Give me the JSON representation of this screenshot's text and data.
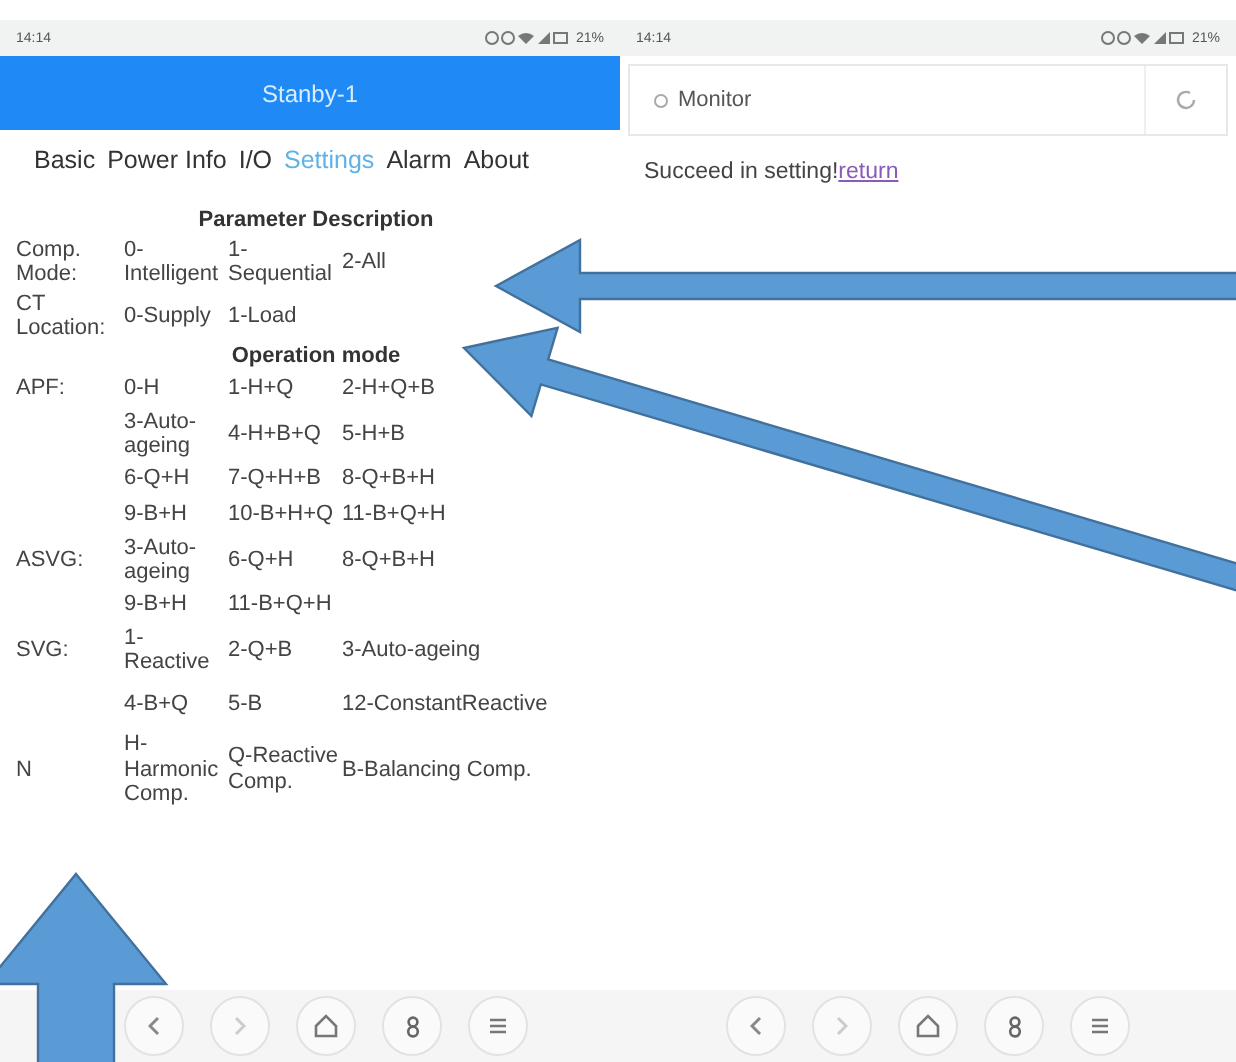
{
  "left_screen": {
    "status_bar": {
      "time": "14:14",
      "battery": "21%"
    },
    "title": "Stanby-1",
    "tabs": [
      {
        "label": "Basic",
        "selected": false
      },
      {
        "label": "Power Info",
        "selected": false
      },
      {
        "label": "I/O",
        "selected": false
      },
      {
        "label": "Settings",
        "selected": true
      },
      {
        "label": "Alarm",
        "selected": false
      },
      {
        "label": "About",
        "selected": false
      }
    ],
    "sections": [
      {
        "heading": "Parameter Description",
        "rows": [
          {
            "label": "Comp. Mode:",
            "values": [
              "0-Intelligent",
              "1-Sequential",
              "2-All"
            ]
          },
          {
            "label": "CT Location:",
            "values": [
              "0-Supply",
              "1-Load"
            ]
          }
        ]
      },
      {
        "heading": "Operation mode",
        "rows": [
          {
            "label": "APF:",
            "values": [
              "0-H",
              "1-H+Q",
              "2-H+Q+B"
            ]
          },
          {
            "label": "",
            "values": [
              "3-Auto-ageing",
              "4-H+B+Q",
              "5-H+B"
            ]
          },
          {
            "label": "",
            "values": [
              "6-Q+H",
              "7-Q+H+B",
              "8-Q+B+H"
            ]
          },
          {
            "label": "",
            "values": [
              "9-B+H",
              "10-B+H+Q",
              "11-B+Q+H"
            ]
          },
          {
            "label": "ASVG:",
            "values": [
              "3-Auto-ageing",
              "6-Q+H",
              "8-Q+B+H"
            ]
          },
          {
            "label": "",
            "values": [
              "9-B+H",
              "11-B+Q+H"
            ]
          },
          {
            "label": "SVG:",
            "values": [
              "1-Reactive",
              "2-Q+B",
              "3-Auto-ageing"
            ]
          },
          {
            "label": "",
            "values": [
              "4-B+Q",
              "5-B",
              "12-ConstantReactive"
            ]
          },
          {
            "label": "N",
            "values": [
              "H-Harmonic Comp.",
              "Q-Reactive Comp.",
              "B-Balancing Comp."
            ]
          }
        ]
      }
    ]
  },
  "right_screen": {
    "status_bar": {
      "time": "14:14",
      "battery": "21%"
    },
    "address": "Monitor",
    "message": "Succeed in setting!",
    "link": "return"
  }
}
